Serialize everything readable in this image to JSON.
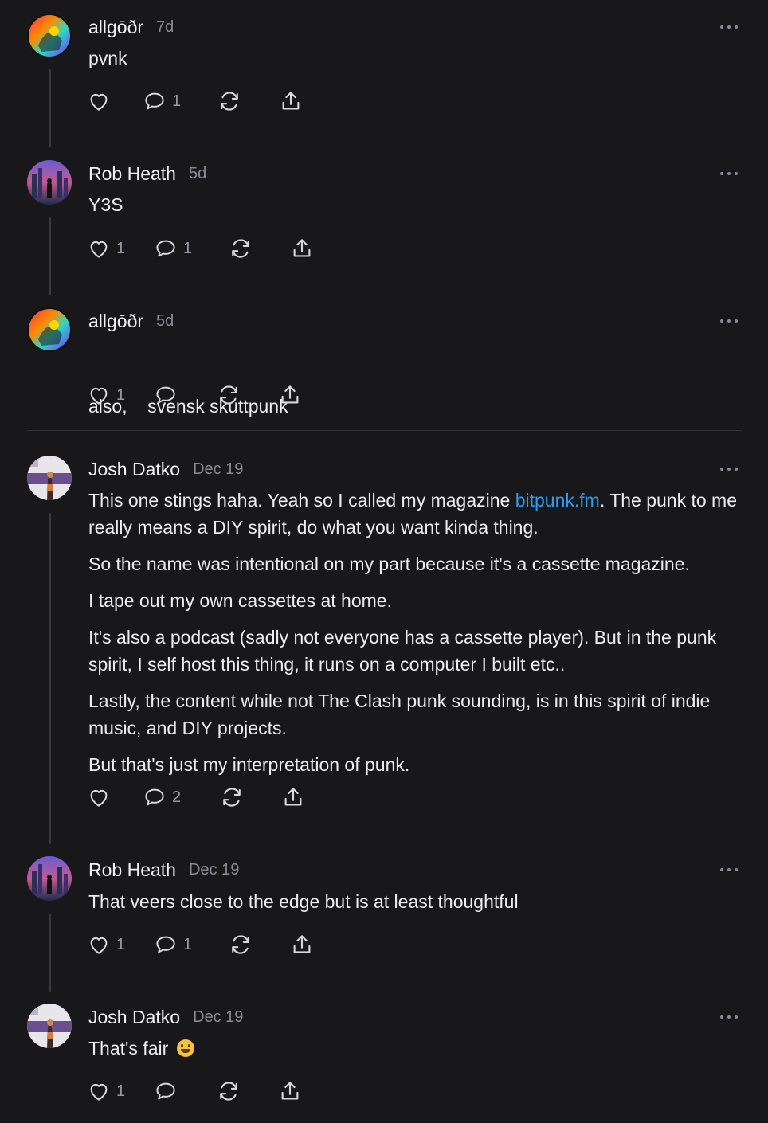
{
  "comments": [
    {
      "author": "allgōðr",
      "time": "7d",
      "avatar": "colorful-abstract-avatar",
      "paragraphs": [
        "pvnk"
      ],
      "likes": "",
      "replies": "1"
    },
    {
      "author": "Rob Heath",
      "time": "5d",
      "avatar": "city-silhouette-avatar",
      "paragraphs": [
        "Y3S"
      ],
      "likes": "1",
      "replies": "1"
    },
    {
      "author": "allgōðr",
      "time": "5d",
      "avatar": "colorful-abstract-avatar",
      "paragraphs": [
        "also,    svensk skuttpunk"
      ],
      "likes": "1",
      "replies": ""
    },
    {
      "author": "Josh Datko",
      "time": "Dec 19",
      "avatar": "person-banner-avatar",
      "first_before": "This one stings haha. Yeah so I called my magazine ",
      "first_link": "bitpunk.fm",
      "first_after": ". The punk to me really means a DIY spirit, do what you want kinda thing.",
      "paragraphs": [
        "So the name was intentional on my part because it's a cassette magazine.",
        "I tape out my own cassettes at home.",
        "It's also a podcast (sadly not everyone has a cassette player). But in the punk spirit, I self host this thing, it runs on a computer I built etc..",
        "Lastly, the content while not The Clash punk sounding, is in this spirit of indie music, and DIY projects.",
        "But that's just my interpretation of punk."
      ],
      "likes": "",
      "replies": "2"
    },
    {
      "author": "Rob Heath",
      "time": "Dec 19",
      "avatar": "city-silhouette-avatar",
      "paragraphs": [
        "That veers close to the edge but is at least thoughtful"
      ],
      "likes": "1",
      "replies": "1"
    },
    {
      "author": "Josh Datko",
      "time": "Dec 19",
      "avatar": "person-banner-avatar",
      "paragraphs": [
        "That's fair"
      ],
      "emoji": "grinning-face-emoji",
      "likes": "1",
      "replies": ""
    }
  ],
  "colors": {
    "background": "#18181a",
    "link": "#2f9cf4",
    "muted": "#8b8b90"
  }
}
